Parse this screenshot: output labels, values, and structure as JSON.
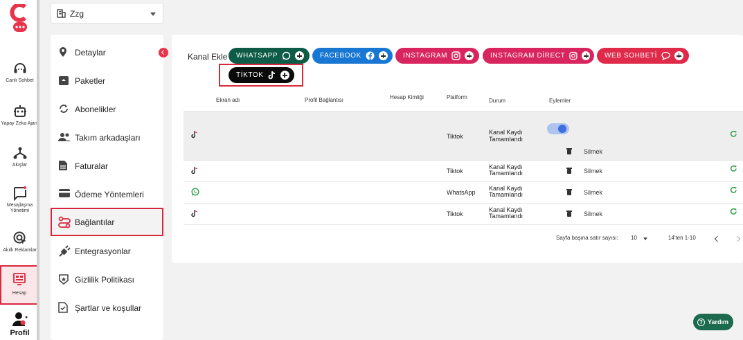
{
  "rail": {
    "items": [
      {
        "label": "Canlı Sohbet"
      },
      {
        "label": "Yapay Zeka Ajanı"
      },
      {
        "label": "Akışlar"
      },
      {
        "label": "Mesajlaşma\nYönetimi"
      },
      {
        "label": "Akıllı Reklamlar"
      },
      {
        "label": "Hesap"
      },
      {
        "label": "Profil"
      }
    ],
    "active": "Hesap"
  },
  "selector": {
    "value": "Zzg"
  },
  "menu": {
    "items": [
      {
        "label": "Detaylar",
        "icon": "location-pin-icon"
      },
      {
        "label": "Paketler",
        "icon": "package-icon"
      },
      {
        "label": "Abonelikler",
        "icon": "sync-icon"
      },
      {
        "label": "Takım arkadaşları",
        "icon": "people-icon"
      },
      {
        "label": "Faturalar",
        "icon": "document-icon"
      },
      {
        "label": "Ödeme Yöntemleri",
        "icon": "credit-card-icon"
      },
      {
        "label": "Bağlantılar",
        "icon": "connection-icon"
      },
      {
        "label": "Entegrasyonlar",
        "icon": "plug-icon"
      },
      {
        "label": "Gizlilik Politikası",
        "icon": "badge-icon"
      },
      {
        "label": "Şartlar ve koşullar",
        "icon": "check-document-icon"
      }
    ],
    "active": "Bağlantılar"
  },
  "channels": {
    "label": "Kanal Ekle",
    "buttons": [
      {
        "label": "WHATSAPP",
        "color": "#0e5c47"
      },
      {
        "label": "FACEBOOK",
        "color": "#1877d2"
      },
      {
        "label": "INSTAGRAM",
        "color": "#d9255f"
      },
      {
        "label": "INSTAGRAM DİRECT",
        "color": "#d9255f"
      },
      {
        "label": "WEB SOHBETİ",
        "color": "#e02a4a"
      },
      {
        "label": "TİKTOK",
        "color": "#0a0a0a"
      }
    ]
  },
  "table": {
    "headers": {
      "name": "Ekran adı",
      "profile": "Profil Bağlantısı",
      "account": "Hesap Kimliği",
      "platform": "Platform",
      "status": "Durum",
      "actions": "Eylemler"
    },
    "rows": [
      {
        "platform": "Tiktok",
        "status1": "Kanal Kaydı",
        "status2": "Tamamlandı",
        "action": "Silmek",
        "icon": "tiktok-icon"
      },
      {
        "platform": "Tiktok",
        "status1": "Kanal Kaydı",
        "status2": "Tamamlandı",
        "action": "Silmek",
        "icon": "tiktok-icon"
      },
      {
        "platform": "WhatsApp",
        "status1": "Kanal Kaydı",
        "status2": "Tamamlandı",
        "action": "Silmek",
        "icon": "whatsapp-icon"
      },
      {
        "platform": "Tiktok",
        "status1": "Kanal Kaydı",
        "status2": "Tamamlandı",
        "action": "Silmek",
        "icon": "tiktok-icon"
      }
    ]
  },
  "pagination": {
    "rows_label": "Sayfa başına satır sayısı:",
    "rows_value": "10",
    "range": "14'ten 1-10"
  },
  "help": {
    "label": "Yardım"
  }
}
